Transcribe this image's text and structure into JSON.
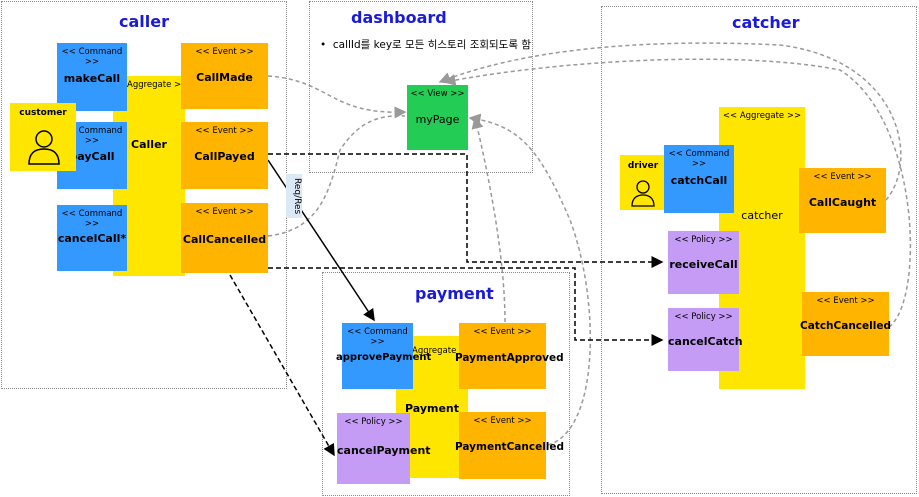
{
  "contexts": {
    "caller": "caller",
    "dashboard": "dashboard",
    "payment": "payment",
    "catcher": "catcher"
  },
  "stereotypes": {
    "command": "<< Command >>",
    "event": "<< Event >>",
    "aggregate": "Aggregate >>",
    "aggregate_full": "<< Aggregate >>",
    "policy": "<< Policy >>",
    "view": "<< View >>"
  },
  "caller": {
    "commands": [
      "makeCall",
      "payCall",
      "cancelCall*"
    ],
    "aggregate": "Caller",
    "events": [
      "CallMade",
      "CallPayed",
      "CallCancelled"
    ],
    "actor": "customer"
  },
  "dashboard": {
    "note": "callId를 key로 모든 히스토리 조회되도록 함",
    "view": "myPage"
  },
  "payment": {
    "command": "approvePayment",
    "policy": "cancelPayment",
    "aggregate": "Payment",
    "events": [
      "PaymentApproved",
      "PaymentCancelled"
    ]
  },
  "catcher": {
    "actor": "driver",
    "command": "catchCall",
    "aggregate": "catcher",
    "policies": [
      "receiveCall",
      "cancelCatch"
    ],
    "events": [
      "CallCaught",
      "CatchCancelled"
    ]
  },
  "link_label": "Req/Res",
  "colors": {
    "command": "#3399ff",
    "event": "#ffb400",
    "aggregate": "#ffe600",
    "policy": "#c49bf5",
    "view": "#22cc55",
    "context_title": "#1a1adc"
  }
}
